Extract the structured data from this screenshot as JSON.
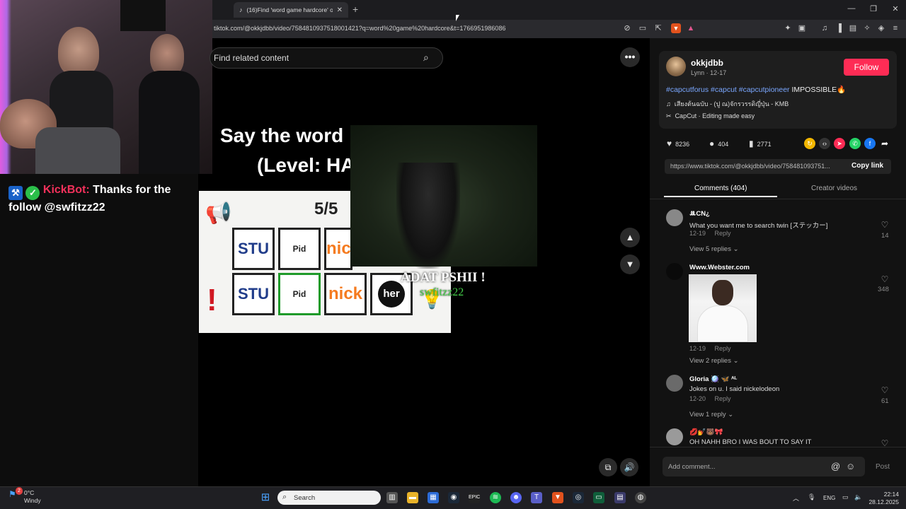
{
  "browser": {
    "tab_title": "(16)Find 'word game hardcore' o",
    "new_tab_label": "+",
    "url": "tiktok.com/@okkjdbb/video/7584810937518001421?q=word%20game%20hardcore&t=1766951986086"
  },
  "stream": {
    "chat_user": "KickBot:",
    "chat_message": "Thanks for the follow @swfitzz22",
    "alert_title": "ADAT PSHII !",
    "alert_user": "swfitzz22"
  },
  "tiktok": {
    "search_placeholder": "Find related content",
    "video_title_line1": "Say the word",
    "video_title_line2": "(Level: HA",
    "game": {
      "score": "5/5",
      "row1": [
        "STU",
        "Pid",
        "nic"
      ],
      "row2": [
        "STU",
        "Pid",
        "nick",
        "her"
      ]
    }
  },
  "post": {
    "author": "okkjdbb",
    "author_sub": "Lynn · 12-17",
    "follow_label": "Follow",
    "hashtags": [
      "#capcutforus",
      "#capcut",
      "#capcutpioneer"
    ],
    "caption_tail": "IMPOSSIBLE🔥",
    "music": "เสียงต้นฉบับ - (ปู ณ)จักรวรรดิญี่ปุ่น - KMB",
    "capcut": "CapCut · Editing made easy",
    "likes": "8236",
    "comments": "404",
    "saves": "2771",
    "link": "https://www.tiktok.com/@okkjdbb/video/758481093751...",
    "copy_link_label": "Copy link",
    "tab_comments": "Comments (404)",
    "tab_creator": "Creator videos"
  },
  "comments": [
    {
      "name": "ꔛCN¿",
      "text": "What you want me to search twin [ステッカー]",
      "date": "12-19",
      "reply": "Reply",
      "likes": "14",
      "replies": "View 5 replies"
    },
    {
      "name": "Www.Webster.com",
      "text": "",
      "date": "12-19",
      "reply": "Reply",
      "likes": "348",
      "replies": "View 2 replies"
    },
    {
      "name": "Gloria 🪩 🦋 ᴬᴸ",
      "text": "Jokes on u. I said nickelodeon",
      "date": "12-20",
      "reply": "Reply",
      "likes": "61",
      "replies": "View 1 reply"
    },
    {
      "name": "💋💅🐻🎀",
      "text": "OH NAHH BRO I WAS BOUT TO SAY IT",
      "date": "",
      "reply": "",
      "likes": "",
      "replies": ""
    }
  ],
  "comment_box": {
    "placeholder": "Add comment...",
    "post_label": "Post"
  },
  "taskbar": {
    "temp": "0°C",
    "condition": "Windy",
    "search_label": "Search",
    "lang": "ENG",
    "time": "22:14",
    "date": "28.12.2025",
    "badge": "2"
  },
  "colors": {
    "follow": "#fe2c55",
    "hashtag": "#7aa7ff",
    "kick_user": "#f2315b",
    "alert_user": "#44d04a"
  }
}
